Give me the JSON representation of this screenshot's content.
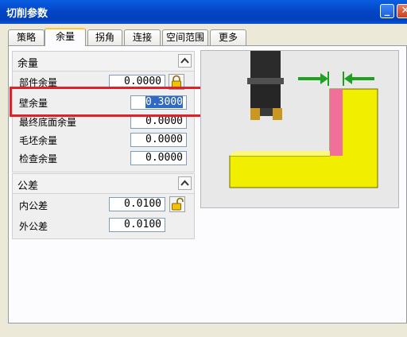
{
  "window": {
    "title": "切削参数"
  },
  "title_buttons": {
    "minimize": "_",
    "close": "✕"
  },
  "tabs": [
    {
      "label": "策略"
    },
    {
      "label": "余量"
    },
    {
      "label": "拐角"
    },
    {
      "label": "连接"
    },
    {
      "label": "空间范围"
    },
    {
      "label": "更多"
    }
  ],
  "active_tab": "余量",
  "stock_group": {
    "title": "余量",
    "rows": [
      {
        "label": "部件余量",
        "value": "0.0000"
      },
      {
        "label": "壁余量",
        "value": "0.3000"
      },
      {
        "label": "最终底面余量",
        "value": "0.0000"
      },
      {
        "label": "毛坯余量",
        "value": "0.0000"
      },
      {
        "label": "检查余量",
        "value": "0.0000"
      }
    ]
  },
  "tolerance_group": {
    "title": "公差",
    "rows": [
      {
        "label": "内公差",
        "value": "0.0100"
      },
      {
        "label": "外公差",
        "value": "0.0100"
      }
    ]
  },
  "colors": {
    "title_bar": "#0346c9",
    "tab_accent": "#ffc83c",
    "selection": "#316ac5",
    "highlight_box": "#e0202a",
    "part_yellow": "#f2ee00",
    "wall_stock_pink": "#f0709a",
    "arrow_green": "#1fa11f"
  },
  "icons": [
    "lock-icon",
    "unlock-icon",
    "chevron-up-icon",
    "minimize-icon",
    "close-icon",
    "cutter-tool-icon"
  ]
}
